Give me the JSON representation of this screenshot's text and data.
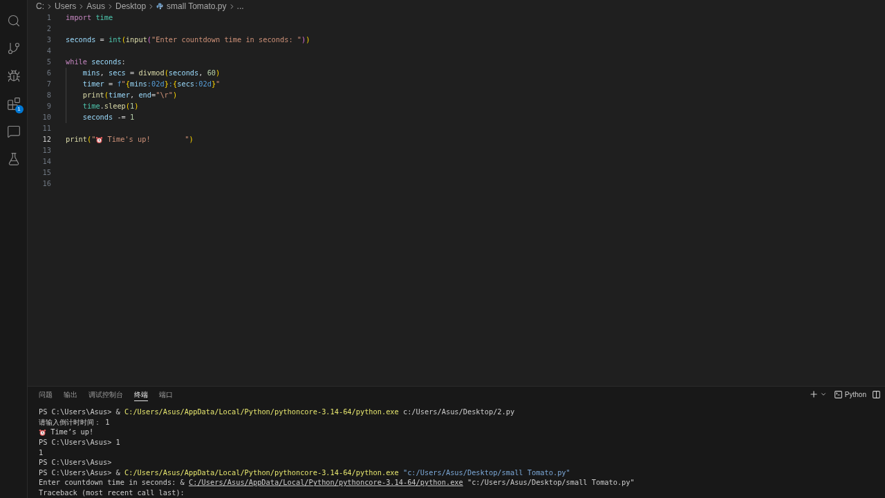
{
  "activity_bar": {
    "items": [
      {
        "kind": "search"
      },
      {
        "kind": "source-control"
      },
      {
        "kind": "run-debug"
      },
      {
        "kind": "extensions",
        "badge": "1"
      },
      {
        "kind": "chat"
      },
      {
        "kind": "testing"
      }
    ]
  },
  "breadcrumb": {
    "items": [
      {
        "kind": "folder",
        "text": "C:"
      },
      {
        "kind": "folder",
        "text": "Users"
      },
      {
        "kind": "folder",
        "text": "Asus"
      },
      {
        "kind": "folder",
        "text": "Desktop"
      },
      {
        "kind": "python-file",
        "text": "small Tomato.py"
      },
      {
        "kind": "more",
        "text": "..."
      }
    ]
  },
  "editor": {
    "lines": [
      {
        "number": "1",
        "current": false,
        "indented": false,
        "tokens": [
          {
            "kind": "keyword",
            "text": "import "
          },
          {
            "kind": "module",
            "text": "time"
          }
        ]
      },
      {
        "number": "2",
        "current": false,
        "indented": false
      },
      {
        "number": "3",
        "current": false,
        "indented": false,
        "tokens": [
          {
            "kind": "variable",
            "text": "seconds"
          },
          {
            "kind": "plain",
            "text": " = "
          },
          {
            "kind": "module",
            "text": "int"
          },
          {
            "kind": "bracket1",
            "text": "("
          },
          {
            "kind": "function",
            "text": "input"
          },
          {
            "kind": "bracket2",
            "text": "("
          },
          {
            "kind": "string",
            "text": "\"Enter countdown time in seconds: \""
          },
          {
            "kind": "bracket2",
            "text": ")"
          },
          {
            "kind": "bracket1",
            "text": ")"
          }
        ]
      },
      {
        "number": "4",
        "current": false,
        "indented": false
      },
      {
        "number": "5",
        "current": false,
        "indented": false,
        "tokens": [
          {
            "kind": "keyword",
            "text": "while "
          },
          {
            "kind": "variable",
            "text": "seconds"
          },
          {
            "kind": "plain",
            "text": ":"
          }
        ]
      },
      {
        "number": "6",
        "current": false,
        "indented": true,
        "tokens": [
          {
            "kind": "variable",
            "text": "mins"
          },
          {
            "kind": "plain",
            "text": ", "
          },
          {
            "kind": "variable",
            "text": "secs"
          },
          {
            "kind": "plain",
            "text": " = "
          },
          {
            "kind": "function",
            "text": "divmod"
          },
          {
            "kind": "bracket1",
            "text": "("
          },
          {
            "kind": "variable",
            "text": "seconds"
          },
          {
            "kind": "plain",
            "text": ", "
          },
          {
            "kind": "number",
            "text": "60"
          },
          {
            "kind": "bracket1",
            "text": ")"
          }
        ]
      },
      {
        "number": "7",
        "current": false,
        "indented": true,
        "tokens": [
          {
            "kind": "variable",
            "text": "timer"
          },
          {
            "kind": "plain",
            "text": " = "
          },
          {
            "kind": "keyword-blue",
            "text": "f"
          },
          {
            "kind": "string",
            "text": "\""
          },
          {
            "kind": "bracket1",
            "text": "{"
          },
          {
            "kind": "variable",
            "text": "mins"
          },
          {
            "kind": "format",
            "text": ":02d"
          },
          {
            "kind": "bracket1",
            "text": "}"
          },
          {
            "kind": "format",
            "text": ":"
          },
          {
            "kind": "bracket1",
            "text": "{"
          },
          {
            "kind": "variable",
            "text": "secs"
          },
          {
            "kind": "format",
            "text": ":02d"
          },
          {
            "kind": "bracket1",
            "text": "}"
          },
          {
            "kind": "string",
            "text": "\""
          }
        ]
      },
      {
        "number": "8",
        "current": false,
        "indented": true,
        "tokens": [
          {
            "kind": "function",
            "text": "print"
          },
          {
            "kind": "bracket1",
            "text": "("
          },
          {
            "kind": "variable",
            "text": "timer"
          },
          {
            "kind": "plain",
            "text": ", "
          },
          {
            "kind": "variable",
            "text": "end"
          },
          {
            "kind": "plain",
            "text": "="
          },
          {
            "kind": "string",
            "text": "\"\\r\""
          },
          {
            "kind": "bracket1",
            "text": ")"
          }
        ]
      },
      {
        "number": "9",
        "current": false,
        "indented": true,
        "tokens": [
          {
            "kind": "module",
            "text": "time"
          },
          {
            "kind": "plain",
            "text": "."
          },
          {
            "kind": "function",
            "text": "sleep"
          },
          {
            "kind": "bracket1",
            "text": "("
          },
          {
            "kind": "number",
            "text": "1"
          },
          {
            "kind": "bracket1",
            "text": ")"
          }
        ]
      },
      {
        "number": "10",
        "current": false,
        "indented": true,
        "tokens": [
          {
            "kind": "variable",
            "text": "seconds"
          },
          {
            "kind": "plain",
            "text": " -= "
          },
          {
            "kind": "number",
            "text": "1"
          }
        ]
      },
      {
        "number": "11",
        "current": false,
        "indented": false
      },
      {
        "number": "12",
        "current": true,
        "indented": false,
        "tokens": [
          {
            "kind": "function",
            "text": "print"
          },
          {
            "kind": "bracket1",
            "text": "("
          },
          {
            "kind": "string",
            "text": "\""
          },
          {
            "kind": "alarm-icon"
          },
          {
            "kind": "string",
            "text": " Time's up!        \""
          },
          {
            "kind": "bracket1",
            "text": ")"
          }
        ]
      },
      {
        "number": "13",
        "current": false,
        "indented": false
      },
      {
        "number": "14",
        "current": false,
        "indented": false
      },
      {
        "number": "15",
        "current": false,
        "indented": false
      },
      {
        "number": "16",
        "current": false,
        "indented": false
      }
    ]
  },
  "panel": {
    "tabs": [
      {
        "label": "问题",
        "selected": false
      },
      {
        "label": "输出",
        "selected": false
      },
      {
        "label": "调试控制台",
        "selected": false
      },
      {
        "label": "终端",
        "selected": true
      },
      {
        "label": "端口",
        "selected": false
      }
    ],
    "terminal_profile": "Python",
    "terminal_lines": [
      [
        {
          "kind": "plain",
          "text": "PS C:\\Users\\Asus> & "
        },
        {
          "kind": "exe",
          "text": "C:/Users/Asus/AppData/Local/Python/pythoncore-3.14-64/python.exe"
        },
        {
          "kind": "plain",
          "text": " c:/Users/Asus/Desktop/2.py"
        }
      ],
      [
        {
          "kind": "plain",
          "text": "请输入倒计时时间： 1"
        }
      ],
      [
        {
          "kind": "alarm-icon"
        },
        {
          "kind": "plain",
          "text": " Time’s up!"
        }
      ],
      [
        {
          "kind": "plain",
          "text": "PS C:\\Users\\Asus> 1"
        }
      ],
      [
        {
          "kind": "plain",
          "text": "1"
        }
      ],
      [
        {
          "kind": "plain",
          "text": "PS C:\\Users\\Asus>"
        }
      ],
      [
        {
          "kind": "plain",
          "text": "PS C:\\Users\\Asus> & "
        },
        {
          "kind": "exe",
          "text": "C:/Users/Asus/AppData/Local/Python/pythoncore-3.14-64/python.exe"
        },
        {
          "kind": "arg",
          "text": "\"c:/Users/Asus/Desktop/small Tomato.py\""
        }
      ],
      [
        {
          "kind": "plain",
          "text": "Enter countdown time in seconds: & "
        },
        {
          "kind": "link",
          "text": "C:/Users/Asus/AppData/Local/Python/pythoncore-3.14-64/python.exe"
        },
        {
          "kind": "plain",
          "text": " \"c:/Users/Asus/Desktop/small Tomato.py\""
        }
      ],
      [
        {
          "kind": "plain",
          "text": "Traceback (most recent call last):"
        }
      ]
    ]
  }
}
